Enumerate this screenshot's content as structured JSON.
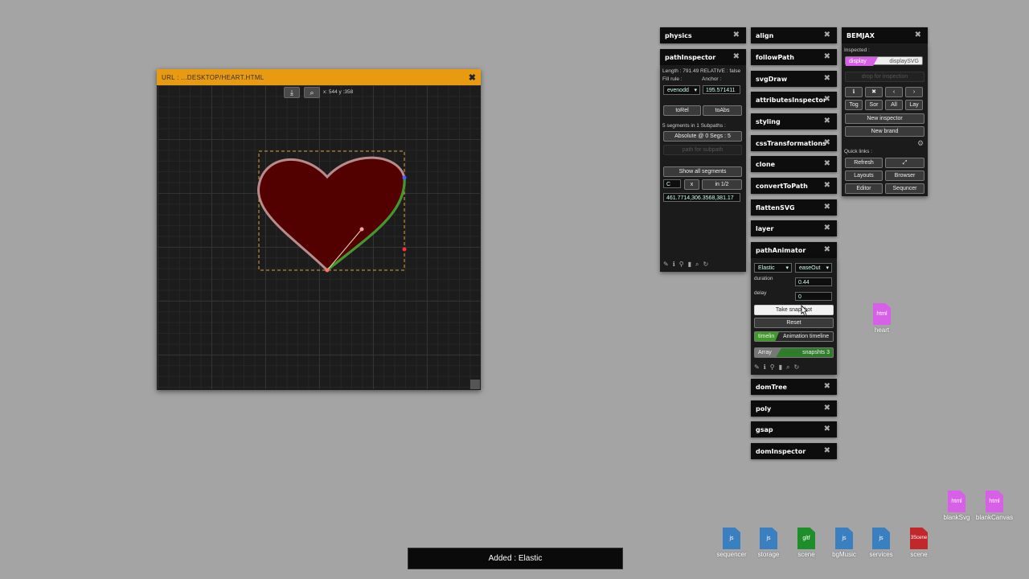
{
  "heart_window": {
    "title": "URL : ...DESKTOP/HEART.HTML",
    "close": "✖",
    "coords": "x: 544 y :358"
  },
  "panels_left": {
    "physics": "physics",
    "pathInspector": "pathInspector"
  },
  "path_inspector": {
    "length": "Length : 791.49 RELATIVE : false",
    "fill_rule_label": "Fill rule :",
    "anchor_label": "Anchor :",
    "fill_rule_value": "evenodd",
    "anchor_value": "195.571411",
    "to_rel": "toRel",
    "to_abs": "toAbs",
    "segments_info": "5 segments in 1 Subpaths :",
    "absolute": "Absolute @ 0 Segs : 5",
    "path_placeholder": "path for subpath",
    "show_all": "Show all segments",
    "seg_cmd": "C",
    "seg_x": "x",
    "seg_index": "in 1/2",
    "seg_value": "461.7714,306.3568,381.17"
  },
  "panels_middle": [
    "align",
    "followPath",
    "svgDraw",
    "attributesInspector",
    "styling",
    "cssTransformations",
    "clone",
    "convertToPath",
    "flattenSVG",
    "layer"
  ],
  "path_animator": {
    "title": "pathAnimator",
    "ease_type": "Elastic",
    "ease_dir": "easeOut",
    "duration_label": "duration",
    "duration_value": "0.44",
    "delay_label": "delay",
    "delay_value": "0",
    "snapshot": "Take snapshot",
    "reset": "Reset",
    "timeline_tag": "timelin",
    "timeline_label": "Animation timeline",
    "array_tag": "Array",
    "snapshots": "snapshts 3"
  },
  "panels_bottom": [
    "domTree",
    "poly",
    "gsap",
    "domInspector"
  ],
  "bemjax": {
    "title": "BEMJAX",
    "inspected_label": "Inspected :",
    "display_tag": "display",
    "display_value": "displaySVG",
    "drop_hint": "drop for inspection",
    "tog": "Tog",
    "sor": "Sor",
    "all": "All",
    "lay": "Lay",
    "new_inspector": "New inspector",
    "new_brand": "New brand",
    "quick_links": "Quick links :",
    "refresh": "Refresh",
    "layouts": "Layouts",
    "browser": "Browser",
    "editor": "Editor",
    "sequencer": "Sequncer"
  },
  "desktop_icons": {
    "heart": {
      "type": "html",
      "name": "heart"
    },
    "blankSvg": {
      "type": "html",
      "name": "blankSvg"
    },
    "blankCanvas": {
      "type": "html",
      "name": "blankCanvas"
    },
    "sequencer": {
      "type": "js",
      "name": "sequencer"
    },
    "storage": {
      "type": "js",
      "name": "storage"
    },
    "scene_gltf": {
      "type": "gltf",
      "name": "scene"
    },
    "bgMusic": {
      "type": "js",
      "name": "bgMusic"
    },
    "services": {
      "type": "js",
      "name": "services"
    },
    "scene_3": {
      "type": "3Scene",
      "name": "scene"
    }
  },
  "toast": "Added : Elastic",
  "colors": {
    "desktop": "#a4a4a4",
    "titlebar": "#e89a10",
    "heart_fill": "#520000",
    "html_icon": "#d860e8",
    "js_icon": "#3a7fbf",
    "gltf_icon": "#1e8e2a",
    "scene3_icon": "#c0282c",
    "green_accent": "#3f9a2a"
  }
}
